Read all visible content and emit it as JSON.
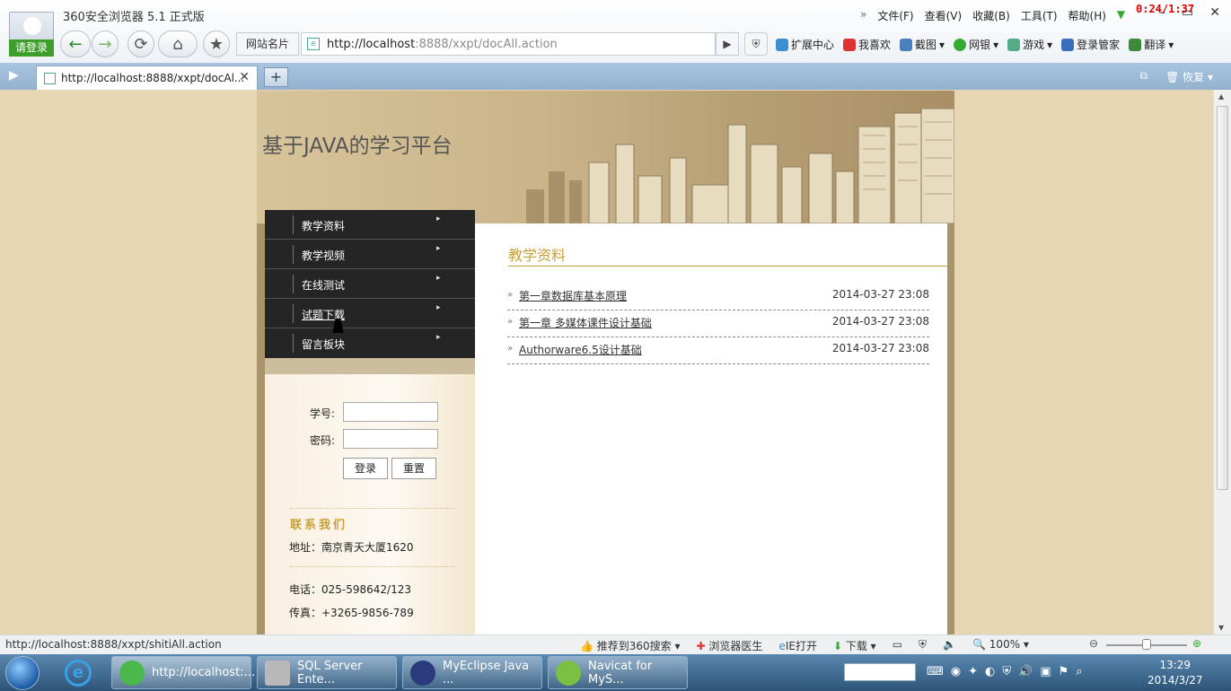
{
  "browser": {
    "title": "360安全浏览器 5.1 正式版",
    "login_badge": "请登录",
    "timer": "0:24/1:37",
    "menu": [
      "文件(F)",
      "查看(V)",
      "收藏(B)",
      "工具(T)",
      "帮助(H)"
    ],
    "site_cards_label": "网站名片",
    "address_host": "http://localhost",
    "address_rest": ":8888/xxpt/docAll.action",
    "toolbar": [
      "扩展中心",
      "我喜欢",
      "截图",
      "网银",
      "游戏",
      "登录管家",
      "翻译"
    ],
    "tab_label": "http://localhost:8888/xxpt/docAl...",
    "restore_label": "恢复"
  },
  "page": {
    "site_title": "基于JAVA的学习平台",
    "nav": [
      "教学资料",
      "教学视频",
      "在线测试",
      "试题下载",
      "留言板块"
    ],
    "login": {
      "id_label": "学号:",
      "pwd_label": "密码:",
      "login_button": "登录",
      "reset_button": "重置"
    },
    "contact": {
      "title": "联系我们",
      "address": "地址：南京青天大厦1620",
      "phone": "电话：025-598642/123",
      "fax": "传真：+3265-9856-789"
    },
    "main": {
      "title": "教学资料",
      "docs": [
        {
          "title": "第一章数据库基本原理",
          "date": "2014-03-27 23:08"
        },
        {
          "title": "第一章 多媒体课件设计基础",
          "date": "2014-03-27 23:08"
        },
        {
          "title": "Authorware6.5设计基础",
          "date": "2014-03-27 23:08"
        }
      ]
    }
  },
  "status": {
    "url": "http://localhost:8888/xxpt/shitiAll.action",
    "items": [
      "推荐到360搜索",
      "浏览器医生",
      "IE打开",
      "下载"
    ],
    "zoom": "100%"
  },
  "taskbar": {
    "tasks": [
      "http://localhost:...",
      "SQL Server Ente...",
      "MyEclipse Java ...",
      "Navicat for MyS..."
    ],
    "time": "13:29",
    "date": "2014/3/27"
  }
}
